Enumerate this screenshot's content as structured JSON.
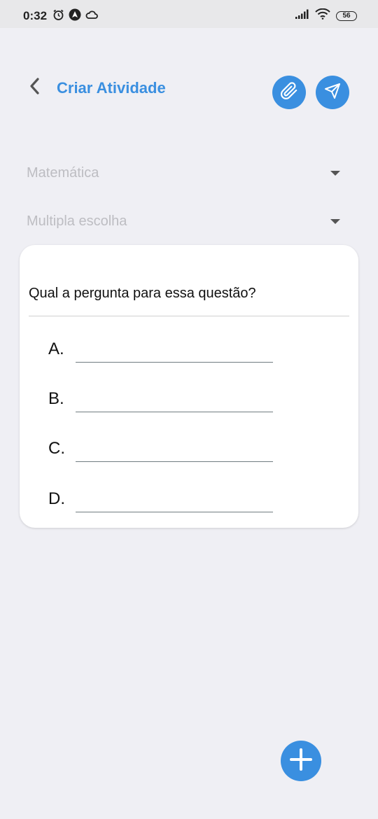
{
  "status_bar": {
    "time": "0:32",
    "battery": "56",
    "left_icons": [
      "alarm-icon",
      "nav-app-icon",
      "cloud-icon"
    ],
    "right_icons": [
      "signal-icon",
      "wifi-icon",
      "battery-icon"
    ]
  },
  "header": {
    "title": "Criar Atividade",
    "back_icon": "chevron-left-icon",
    "attach_icon": "paperclip-icon",
    "send_icon": "send-icon"
  },
  "form": {
    "subject_select": {
      "value": "Matemática"
    },
    "type_select": {
      "value": "Multipla escolha"
    }
  },
  "question_card": {
    "question_placeholder": "Qual a pergunta para essa questão?",
    "options": [
      {
        "letter": "A.",
        "value": ""
      },
      {
        "letter": "B.",
        "value": ""
      },
      {
        "letter": "C.",
        "value": ""
      },
      {
        "letter": "D.",
        "value": ""
      }
    ]
  },
  "fab": {
    "icon": "plus-icon"
  },
  "colors": {
    "accent": "#3a8fe0",
    "background": "#efeff4",
    "card": "#ffffff",
    "placeholder": "#bdbdc2"
  }
}
